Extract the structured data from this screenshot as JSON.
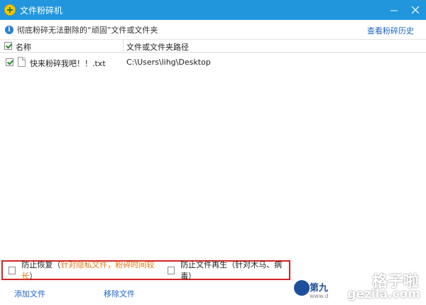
{
  "window": {
    "title": "文件粉碎机",
    "minimize_icon": "minimize-icon",
    "close_icon": "close-icon"
  },
  "info_bar": {
    "text": "彻底粉碎无法删除的“顽固”文件或文件夹",
    "history_link": "查看粉碎历史"
  },
  "table": {
    "columns": [
      "名称",
      "文件或文件夹路径"
    ],
    "rows": [
      {
        "checked": true,
        "name": "快来粉碎我吧！！.txt",
        "path": "C:\\Users\\lihg\\Desktop"
      }
    ]
  },
  "options": {
    "prevent_recovery": {
      "label": "防止恢复",
      "paren_open": "（",
      "note": "针对隐私文件，粉碎时间较长",
      "paren_close": "）",
      "checked": false
    },
    "prevent_regen": {
      "label": "防止文件再生（针对木马、病毒）",
      "checked": false
    }
  },
  "footer": {
    "add_file": "添加文件",
    "remove_file": "移除文件"
  },
  "watermark": {
    "brand": "第九",
    "sub": "www.d",
    "cn": "格子啦",
    "en": "gezila.com"
  },
  "colors": {
    "titlebar": "#2196dd",
    "link": "#1a64c8",
    "note": "#e07818",
    "highlight_border": "#d22424"
  }
}
